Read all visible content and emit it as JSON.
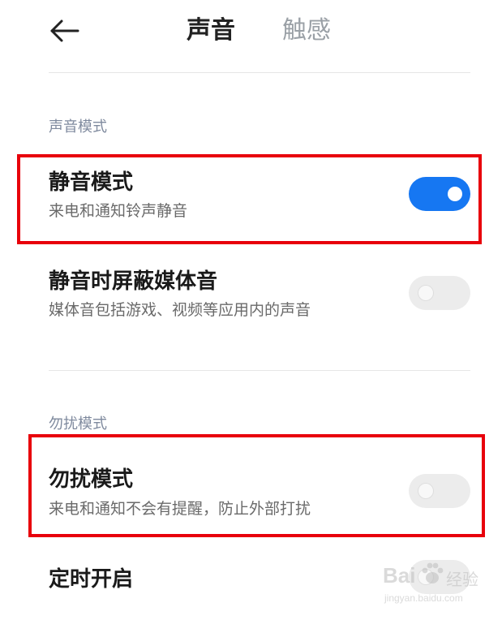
{
  "header": {
    "tabs": [
      {
        "label": "声音",
        "active": true
      },
      {
        "label": "触感",
        "active": false
      }
    ]
  },
  "sections": [
    {
      "title": "声音模式",
      "items": [
        {
          "title": "静音模式",
          "subtitle": "来电和通知铃声静音",
          "toggle_on": true
        },
        {
          "title": "静音时屏蔽媒体音",
          "subtitle": "媒体音包括游戏、视频等应用内的声音",
          "toggle_on": false
        }
      ]
    },
    {
      "title": "勿扰模式",
      "items": [
        {
          "title": "勿扰模式",
          "subtitle": "来电和通知不会有提醒，防止外部打扰",
          "toggle_on": false
        },
        {
          "title": "定时开启",
          "toggle_on": false
        }
      ]
    }
  ],
  "watermark": {
    "brand": "Bai",
    "brand_suffix": "经验",
    "url": "jingyan.baidu.com"
  },
  "colors": {
    "accent": "#1677f2",
    "highlight": "#e8000b",
    "section_title": "#7f8a9e"
  }
}
